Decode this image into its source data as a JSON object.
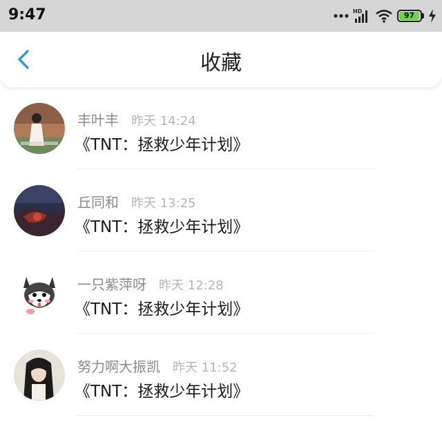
{
  "status_bar": {
    "time": "9:47",
    "battery_level": "97",
    "battery_percent": 97,
    "icons": [
      "dots-icon",
      "hd-signal-icon",
      "wifi-icon",
      "battery-icon",
      "charging-icon"
    ]
  },
  "nav": {
    "title": "收藏",
    "back_icon": "chevron-left-icon",
    "accent_color": "#2b9bd8"
  },
  "items": [
    {
      "name": "丰叶丰",
      "time": "昨天 14:24",
      "text": "《TNT：拯救少年计划》",
      "avatar": "photo-girl-white-dress"
    },
    {
      "name": "丘同和",
      "time": "昨天 13:25",
      "text": "《TNT：拯救少年计划》",
      "avatar": "photo-dark-landscape"
    },
    {
      "name": "一只紫萍呀",
      "time": "昨天 12:28",
      "text": "《TNT：拯救少年计划》",
      "avatar": "cartoon-husky-dog"
    },
    {
      "name": "努力啊大振凯",
      "time": "昨天 11:52",
      "text": "《TNT：拯救少年计划》",
      "avatar": "photo-girl-black-hair"
    }
  ]
}
